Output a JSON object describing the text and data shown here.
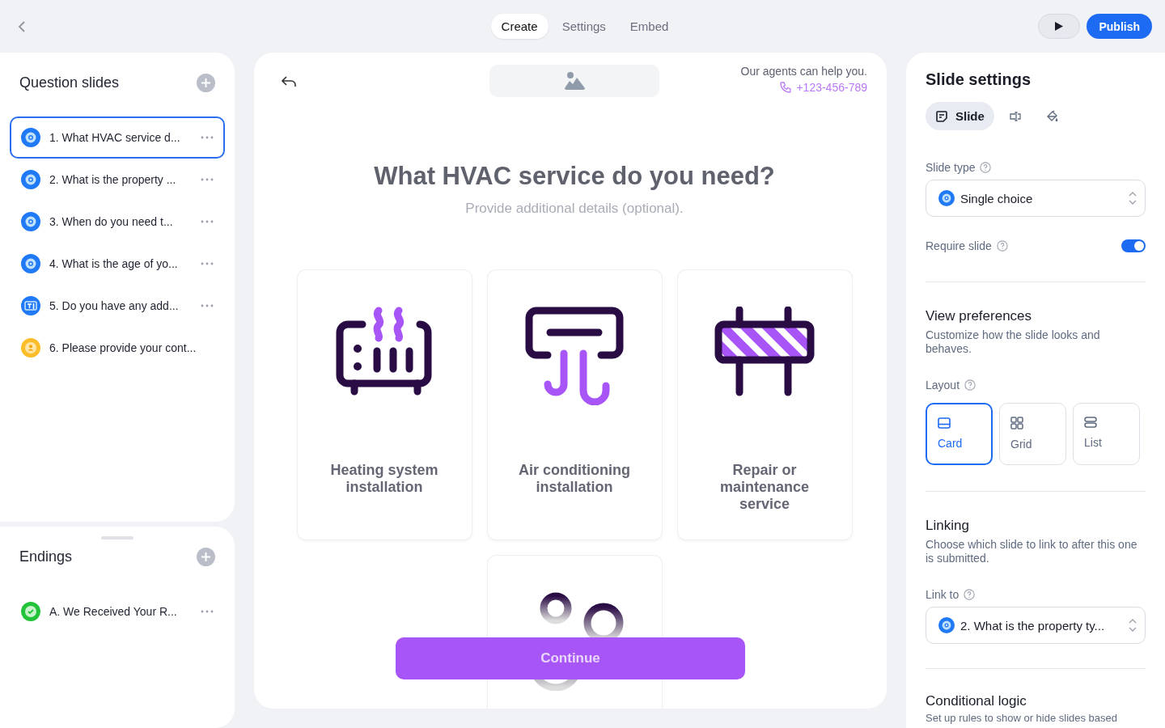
{
  "top_bar": {
    "tabs": [
      {
        "label": "Create",
        "selected": true
      },
      {
        "label": "Settings",
        "selected": false
      },
      {
        "label": "Embed",
        "selected": false
      }
    ],
    "publish": "Publish"
  },
  "question_slides": {
    "title": "Question slides",
    "items": [
      {
        "kind": "choice",
        "label": "1. What HVAC service d...",
        "selected": true,
        "menu": true
      },
      {
        "kind": "choice",
        "label": "2. What is the property ...",
        "selected": false,
        "menu": true
      },
      {
        "kind": "choice",
        "label": "3. When do you need t...",
        "selected": false,
        "menu": true
      },
      {
        "kind": "choice",
        "label": "4. What is the age of yo...",
        "selected": false,
        "menu": true
      },
      {
        "kind": "text",
        "label": "5. Do you have any add...",
        "selected": false,
        "menu": true
      },
      {
        "kind": "contact",
        "label": "6. Please provide your cont...",
        "selected": false,
        "menu": false
      }
    ]
  },
  "endings": {
    "title": "Endings",
    "items": [
      {
        "kind": "ending",
        "label": "A. We Received Your R...",
        "selected": false,
        "menu": true
      }
    ]
  },
  "slide": {
    "help_text": "Our agents can help you.",
    "phone": "+123-456-789",
    "title": "What HVAC service do you need?",
    "subtitle": "Provide additional details (optional).",
    "options": [
      {
        "kind": "heater",
        "label": "Heating system installation"
      },
      {
        "kind": "ac",
        "label": "Air conditioning installation"
      },
      {
        "kind": "barrier",
        "label": "Repair or maintenance service"
      },
      {
        "kind": "bubbles"
      }
    ],
    "continue": "Continue"
  },
  "settings": {
    "title": "Slide settings",
    "tabs": [
      {
        "kind": "slide",
        "label": "Slide",
        "selected": true
      },
      {
        "kind": "input",
        "selected": false
      },
      {
        "kind": "paint",
        "selected": false
      }
    ],
    "slide_type_label": "Slide type",
    "slide_type": "Single choice",
    "require_label": "Require slide",
    "require_on": true,
    "view_title": "View preferences",
    "view_desc": "Customize how the slide looks and behaves.",
    "layout_label": "Layout",
    "layouts": [
      {
        "kind": "card",
        "label": "Card",
        "selected": true
      },
      {
        "kind": "grid",
        "label": "Grid",
        "selected": false
      },
      {
        "kind": "list",
        "label": "List",
        "selected": false
      }
    ],
    "linking_title": "Linking",
    "linking_desc": "Choose which slide to link to after this one is submitted.",
    "link_label": "Link to",
    "link_value": "2. What is the property ty...",
    "logic_title": "Conditional logic",
    "logic_desc": "Set up rules to show or hide slides based"
  }
}
